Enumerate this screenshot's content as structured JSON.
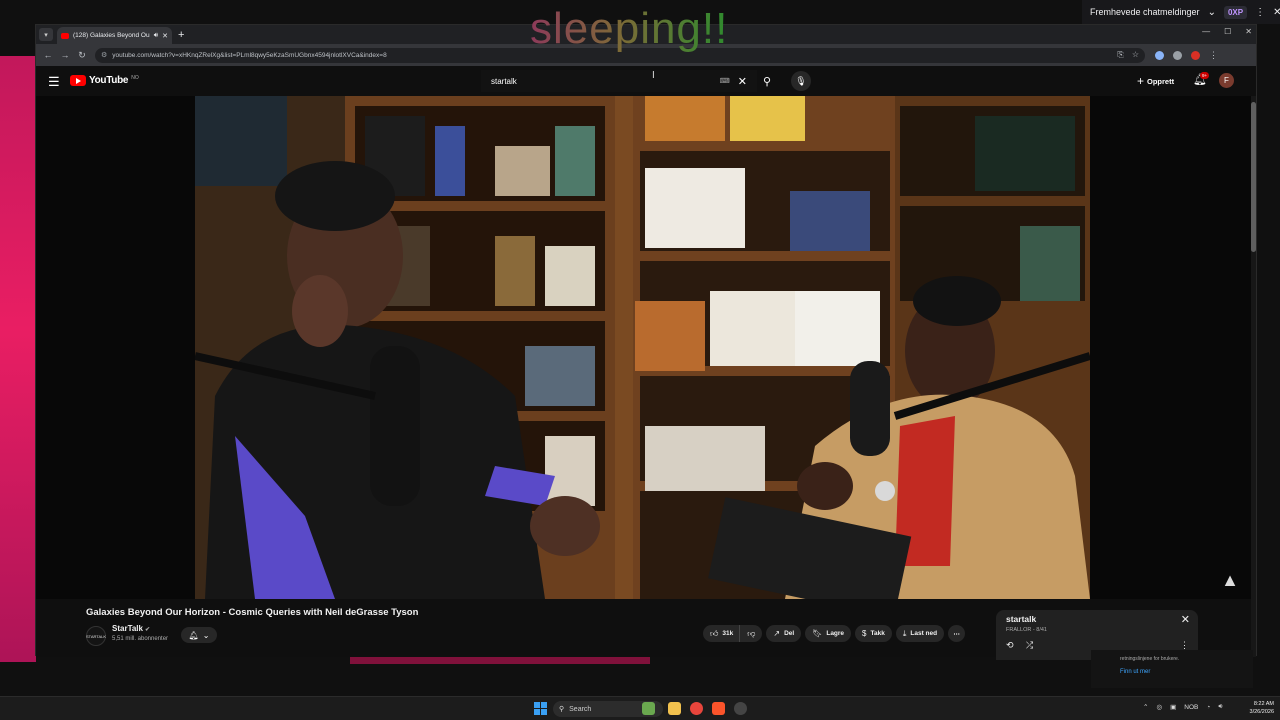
{
  "overlay": {
    "caption": "sleeping!!"
  },
  "twitch": {
    "featured_label": "Fremhevede chatmeldinger",
    "badge": "0XP"
  },
  "browser": {
    "tab_title": "(128) Galaxies Beyond Our",
    "url": "youtube.com/watch?v=xHKnqZRelXg&list=PLml8qwy5eKzaSmUGbnx4594jnlotlXVCa&index=8"
  },
  "youtube": {
    "logo_text": "YouTube",
    "logo_region": "NO",
    "search_value": "startalk",
    "create_label": "Opprett",
    "notif_count": "9+",
    "avatar_letter": "F"
  },
  "video": {
    "title": "Galaxies Beyond Our Horizon - Cosmic Queries with Neil deGrasse Tyson",
    "channel_name": "StarTalk",
    "channel_avatar_text": "STARTALK",
    "subscribers": "5,51 mill. abonnenter",
    "likes": "31k",
    "share_label": "Del",
    "save_label": "Lagre",
    "thanks_label": "Takk",
    "download_label": "Last ned"
  },
  "playlist": {
    "title": "startalk",
    "subtitle": "FRALLOR - 8/41"
  },
  "under_panel": {
    "text": "retningslinjene for brukere.",
    "link": "Finn ut mer"
  },
  "taskbar": {
    "search_placeholder": "Search",
    "lang": "NOB",
    "time": "8:22 AM",
    "date": "3/26/2026"
  },
  "colors": {
    "youtube_red": "#ff0000",
    "accent_pink": "#e91e63",
    "link_blue": "#3ea6ff"
  }
}
